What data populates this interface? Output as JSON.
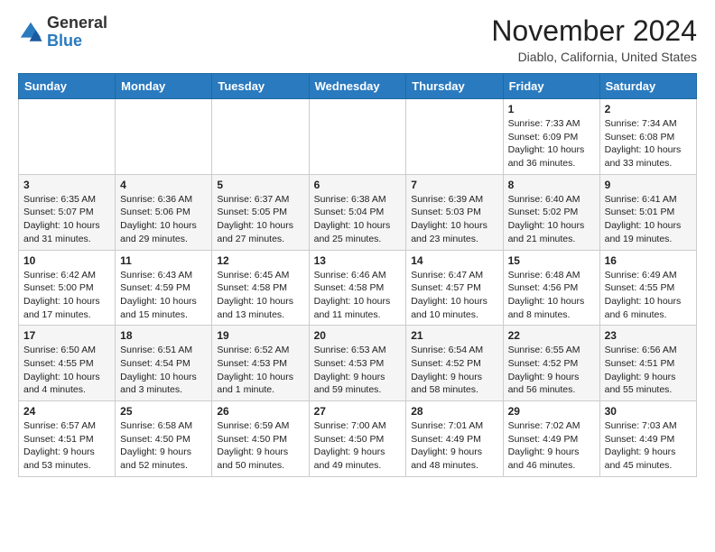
{
  "logo": {
    "text_general": "General",
    "text_blue": "Blue"
  },
  "header": {
    "month": "November 2024",
    "location": "Diablo, California, United States"
  },
  "weekdays": [
    "Sunday",
    "Monday",
    "Tuesday",
    "Wednesday",
    "Thursday",
    "Friday",
    "Saturday"
  ],
  "rows": [
    {
      "cells": [
        {
          "day": "",
          "info": ""
        },
        {
          "day": "",
          "info": ""
        },
        {
          "day": "",
          "info": ""
        },
        {
          "day": "",
          "info": ""
        },
        {
          "day": "",
          "info": ""
        },
        {
          "day": "1",
          "info": "Sunrise: 7:33 AM\nSunset: 6:09 PM\nDaylight: 10 hours\nand 36 minutes."
        },
        {
          "day": "2",
          "info": "Sunrise: 7:34 AM\nSunset: 6:08 PM\nDaylight: 10 hours\nand 33 minutes."
        }
      ]
    },
    {
      "cells": [
        {
          "day": "3",
          "info": "Sunrise: 6:35 AM\nSunset: 5:07 PM\nDaylight: 10 hours\nand 31 minutes."
        },
        {
          "day": "4",
          "info": "Sunrise: 6:36 AM\nSunset: 5:06 PM\nDaylight: 10 hours\nand 29 minutes."
        },
        {
          "day": "5",
          "info": "Sunrise: 6:37 AM\nSunset: 5:05 PM\nDaylight: 10 hours\nand 27 minutes."
        },
        {
          "day": "6",
          "info": "Sunrise: 6:38 AM\nSunset: 5:04 PM\nDaylight: 10 hours\nand 25 minutes."
        },
        {
          "day": "7",
          "info": "Sunrise: 6:39 AM\nSunset: 5:03 PM\nDaylight: 10 hours\nand 23 minutes."
        },
        {
          "day": "8",
          "info": "Sunrise: 6:40 AM\nSunset: 5:02 PM\nDaylight: 10 hours\nand 21 minutes."
        },
        {
          "day": "9",
          "info": "Sunrise: 6:41 AM\nSunset: 5:01 PM\nDaylight: 10 hours\nand 19 minutes."
        }
      ]
    },
    {
      "cells": [
        {
          "day": "10",
          "info": "Sunrise: 6:42 AM\nSunset: 5:00 PM\nDaylight: 10 hours\nand 17 minutes."
        },
        {
          "day": "11",
          "info": "Sunrise: 6:43 AM\nSunset: 4:59 PM\nDaylight: 10 hours\nand 15 minutes."
        },
        {
          "day": "12",
          "info": "Sunrise: 6:45 AM\nSunset: 4:58 PM\nDaylight: 10 hours\nand 13 minutes."
        },
        {
          "day": "13",
          "info": "Sunrise: 6:46 AM\nSunset: 4:58 PM\nDaylight: 10 hours\nand 11 minutes."
        },
        {
          "day": "14",
          "info": "Sunrise: 6:47 AM\nSunset: 4:57 PM\nDaylight: 10 hours\nand 10 minutes."
        },
        {
          "day": "15",
          "info": "Sunrise: 6:48 AM\nSunset: 4:56 PM\nDaylight: 10 hours\nand 8 minutes."
        },
        {
          "day": "16",
          "info": "Sunrise: 6:49 AM\nSunset: 4:55 PM\nDaylight: 10 hours\nand 6 minutes."
        }
      ]
    },
    {
      "cells": [
        {
          "day": "17",
          "info": "Sunrise: 6:50 AM\nSunset: 4:55 PM\nDaylight: 10 hours\nand 4 minutes."
        },
        {
          "day": "18",
          "info": "Sunrise: 6:51 AM\nSunset: 4:54 PM\nDaylight: 10 hours\nand 3 minutes."
        },
        {
          "day": "19",
          "info": "Sunrise: 6:52 AM\nSunset: 4:53 PM\nDaylight: 10 hours\nand 1 minute."
        },
        {
          "day": "20",
          "info": "Sunrise: 6:53 AM\nSunset: 4:53 PM\nDaylight: 9 hours\nand 59 minutes."
        },
        {
          "day": "21",
          "info": "Sunrise: 6:54 AM\nSunset: 4:52 PM\nDaylight: 9 hours\nand 58 minutes."
        },
        {
          "day": "22",
          "info": "Sunrise: 6:55 AM\nSunset: 4:52 PM\nDaylight: 9 hours\nand 56 minutes."
        },
        {
          "day": "23",
          "info": "Sunrise: 6:56 AM\nSunset: 4:51 PM\nDaylight: 9 hours\nand 55 minutes."
        }
      ]
    },
    {
      "cells": [
        {
          "day": "24",
          "info": "Sunrise: 6:57 AM\nSunset: 4:51 PM\nDaylight: 9 hours\nand 53 minutes."
        },
        {
          "day": "25",
          "info": "Sunrise: 6:58 AM\nSunset: 4:50 PM\nDaylight: 9 hours\nand 52 minutes."
        },
        {
          "day": "26",
          "info": "Sunrise: 6:59 AM\nSunset: 4:50 PM\nDaylight: 9 hours\nand 50 minutes."
        },
        {
          "day": "27",
          "info": "Sunrise: 7:00 AM\nSunset: 4:50 PM\nDaylight: 9 hours\nand 49 minutes."
        },
        {
          "day": "28",
          "info": "Sunrise: 7:01 AM\nSunset: 4:49 PM\nDaylight: 9 hours\nand 48 minutes."
        },
        {
          "day": "29",
          "info": "Sunrise: 7:02 AM\nSunset: 4:49 PM\nDaylight: 9 hours\nand 46 minutes."
        },
        {
          "day": "30",
          "info": "Sunrise: 7:03 AM\nSunset: 4:49 PM\nDaylight: 9 hours\nand 45 minutes."
        }
      ]
    }
  ]
}
